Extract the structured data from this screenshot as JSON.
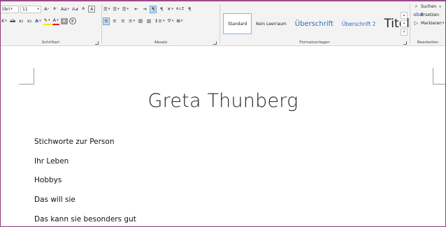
{
  "ribbon": {
    "font": {
      "name_partial": "libri",
      "size": "11",
      "grow": "A",
      "shrink": "A",
      "case": "Aa",
      "clear": "A",
      "phonetic": "A",
      "char_border": "A",
      "italic": "K",
      "strike": "ab",
      "subscript": "x",
      "superscript": "x",
      "effects": "A",
      "highlight": "✎",
      "font_color": "A",
      "char_shading": "A",
      "enclosed": "字",
      "label": "Schriftart"
    },
    "paragraph": {
      "sort": "A↓Z",
      "pilcrow": "¶",
      "label": "Absatz"
    },
    "styles": {
      "items": [
        {
          "label": "Standard",
          "size": 6,
          "color": "#222222"
        },
        {
          "label": "Kein Leerraum",
          "size": 6,
          "color": "#222222"
        },
        {
          "label": "Überschrift",
          "size": 10,
          "color": "#2f6eb5"
        },
        {
          "label": "Überschrift 2",
          "size": 7.5,
          "color": "#2f6eb5"
        },
        {
          "label": "Titel",
          "size": 17,
          "color": "#222222"
        }
      ],
      "label": "Formatvorlagen"
    },
    "editing": {
      "search": "Suchen",
      "replace": "Ersetzen",
      "select": "Markieren",
      "label": "Bearbeiten"
    }
  },
  "document": {
    "title": "Greta Thunberg",
    "paragraphs": [
      "Stichworte zur Person",
      "Ihr Leben",
      "Hobbys",
      "Das will sie",
      "Das kann sie besonders gut"
    ]
  }
}
